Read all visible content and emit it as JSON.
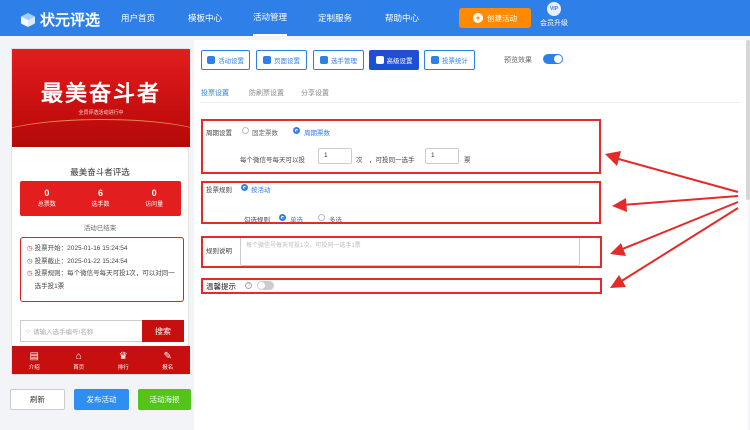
{
  "header": {
    "logo_text": "状元评选",
    "nav": [
      "用户首页",
      "模板中心",
      "活动管理",
      "定制服务",
      "帮助中心"
    ],
    "create_button": "创建活动",
    "vip_badge": "VIP",
    "vip_label": "会员升级"
  },
  "preview": {
    "banner_title": "最美奋斗者",
    "banner_sub": "全员评选活动进行中",
    "event_title": "最美奋斗者评选",
    "stats": [
      {
        "value": "0",
        "label": "总票数"
      },
      {
        "value": "6",
        "label": "选手数"
      },
      {
        "value": "0",
        "label": "访问量"
      }
    ],
    "status": "活动已结束",
    "info": [
      "投票开始：2025-01-16 15:24:54",
      "投票截止：2025-01-22 15:24:54",
      "投票规则：每个微信号每天可投1次，可以对同一选手投1票"
    ],
    "search_placeholder": "请输入选手编号/名称",
    "search_button": "搜索",
    "tabs": [
      "介绍",
      "首页",
      "排行",
      "报名"
    ]
  },
  "actions": {
    "refresh": "刷新",
    "publish": "发布活动",
    "poster": "活动海报"
  },
  "settings": {
    "tool_buttons": [
      "活动设置",
      "页面设置",
      "选手管理",
      "高级设置",
      "投票统计"
    ],
    "preview_label": "预览效果",
    "subtabs": [
      "投票设置",
      "防刷票设置",
      "分享设置"
    ],
    "period": {
      "label": "周期设置",
      "option_fixed": "固定票数",
      "option_cycle": "周期票数",
      "text1": "每个微信号每天可以投",
      "value1": "1",
      "text2": "次",
      "text3": "，可投同一选手",
      "value2": "1",
      "text4": "票"
    },
    "rule": {
      "label": "投票规则",
      "option_activity": "按活动",
      "select_label": "勾选规则",
      "option_single": "单选",
      "option_multi": "多选"
    },
    "description": {
      "label": "规则说明",
      "placeholder": "每个微信号每天可投1次，可投同一选手1票"
    },
    "tip": {
      "label": "温馨提示",
      "help": "?"
    }
  },
  "colors": {
    "brand_blue": "#2f7fe8",
    "banner_red": "#e21e1e",
    "highlight_red": "#e52a2a",
    "create_orange": "#ff8a00"
  }
}
